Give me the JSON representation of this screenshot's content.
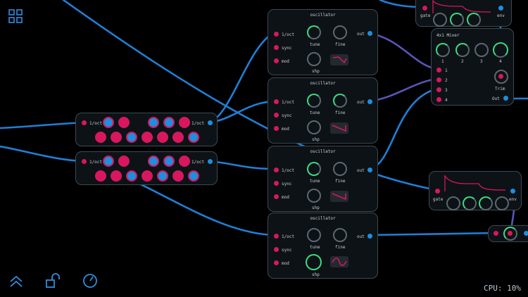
{
  "toolbar": {
    "grid_icon": "grid-icon",
    "collapse_icon": "chevron-double-up-icon",
    "lock_icon": "unlock-icon",
    "clock_icon": "clock-icon"
  },
  "status": {
    "cpu": "CPU: 10%"
  },
  "sequencers": [
    {
      "in_label": "1/oct",
      "out_label": "1/oct"
    },
    {
      "in_label": "1/oct",
      "out_label": "1/oct"
    }
  ],
  "oscillators": [
    {
      "title": "oscillator",
      "in1": "1/oct",
      "in2": "sync",
      "in3": "mod",
      "out": "out",
      "tune": "tune",
      "fine": "fine",
      "shp": "shp"
    },
    {
      "title": "oscillator",
      "in1": "1/oct",
      "in2": "sync",
      "in3": "mod",
      "out": "out",
      "tune": "tune",
      "fine": "fine",
      "shp": "shp"
    },
    {
      "title": "oscillator",
      "in1": "1/oct",
      "in2": "sync",
      "in3": "mod",
      "out": "out",
      "tune": "tune",
      "fine": "fine",
      "shp": "shp"
    },
    {
      "title": "oscillator",
      "in1": "1/oct",
      "in2": "sync",
      "in3": "mod",
      "out": "out",
      "tune": "tune",
      "fine": "fine",
      "shp": "shp"
    }
  ],
  "mixer": {
    "title": "4x1 Mixer",
    "knob_labels": [
      "1",
      "2",
      "3",
      "4"
    ],
    "inputs": [
      "1",
      "2",
      "3",
      "4"
    ],
    "trim": "Trim",
    "out": "Out"
  },
  "envelopes": [
    {
      "gate": "gate",
      "env": "env"
    },
    {
      "gate": "gate",
      "env": "env"
    }
  ],
  "colors": {
    "cable": "#1f7fd6",
    "cable_purple": "#5a55b8",
    "input": "#d8175f",
    "output": "#1d8fe0",
    "knob_active": "#3ddc84"
  }
}
